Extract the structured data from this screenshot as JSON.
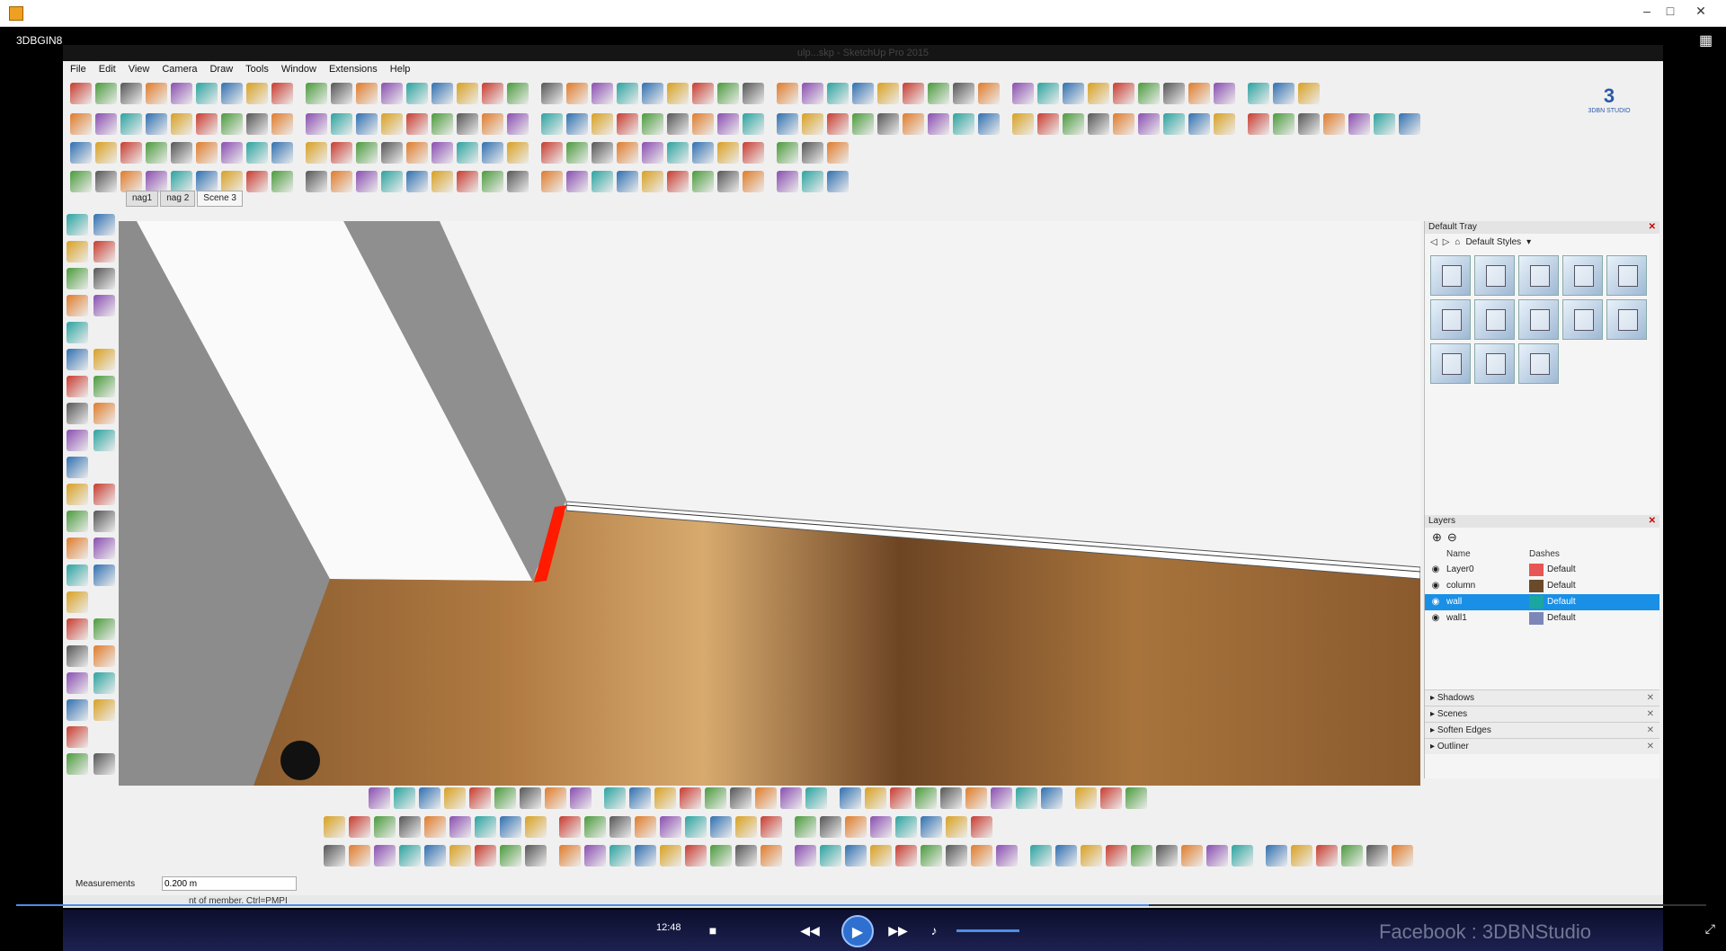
{
  "player": {
    "label": "3DBGIN8",
    "time": "12:48",
    "watermark": "Facebook : 3DBNStudio",
    "progress_fraction": 0.67,
    "window_controls": [
      "–",
      "□",
      "✕"
    ]
  },
  "sketchup": {
    "title": "ulp...skp - SketchUp Pro 2015",
    "menu": [
      "File",
      "Edit",
      "View",
      "Camera",
      "Draw",
      "Tools",
      "Window",
      "Extensions",
      "Help"
    ],
    "logo": {
      "mark": "3",
      "text": "3DBN STUDIO"
    },
    "scene_tabs": [
      "nag1",
      "nag 2",
      "Scene 3"
    ],
    "active_tab": "Scene 3",
    "measurements_label": "Measurements",
    "measurements_value": "0.200 m",
    "status_text": "nt of member. Ctrl=PMPI",
    "tray": {
      "title": "Default Tray",
      "styles_dropdown": "Default Styles",
      "style_count": 13,
      "layers_title": "Layers",
      "col_name": "Name",
      "col_dashes": "Dashes",
      "layers": [
        {
          "name": "Layer0",
          "color": "#e85555",
          "dashes": "Default",
          "selected": false
        },
        {
          "name": "column",
          "color": "#6b4a2a",
          "dashes": "Default",
          "selected": false
        },
        {
          "name": "wall",
          "color": "#1aa7a0",
          "dashes": "Default",
          "selected": true
        },
        {
          "name": "wall1",
          "color": "#7c86b8",
          "dashes": "Default",
          "selected": false
        }
      ],
      "collapsed_panels": [
        "Shadows",
        "Scenes",
        "Soften Edges",
        "Outliner"
      ]
    }
  }
}
